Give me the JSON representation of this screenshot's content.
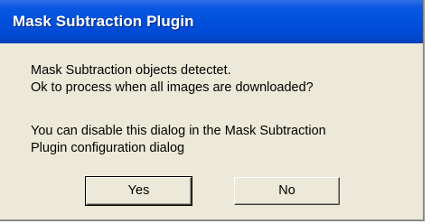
{
  "window": {
    "title": "Mask Subtraction Plugin"
  },
  "message": {
    "line1": "Mask Subtraction objects detectet.",
    "line2": "Ok to process when all images are downloaded?",
    "line3": "You can disable this dialog in the Mask Subtraction",
    "line4": "Plugin configuration dialog"
  },
  "buttons": {
    "yes_label": "Yes",
    "no_label": "No"
  },
  "colors": {
    "titlebar": "#0050dc",
    "dialog_bg": "#ece9d8",
    "title_text": "#ffffff"
  }
}
